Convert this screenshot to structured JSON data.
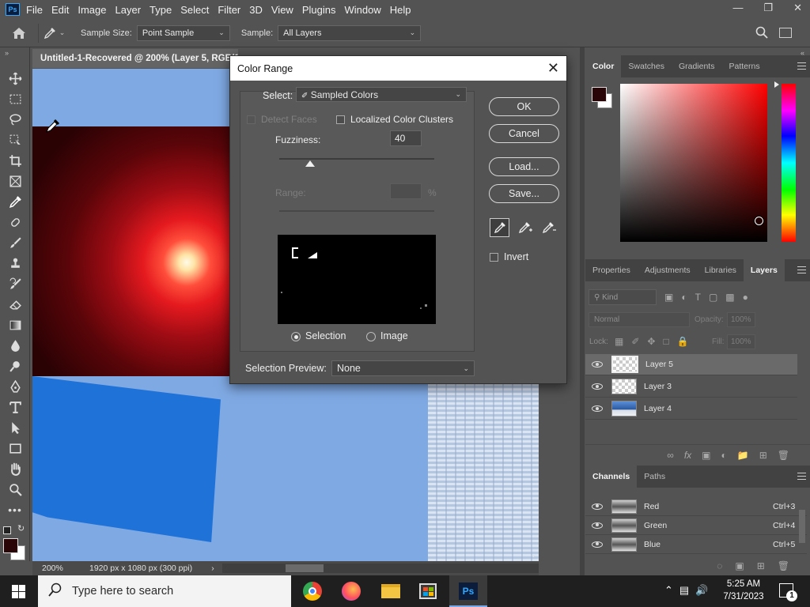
{
  "app": {
    "logo_text": "Ps",
    "menu": [
      "File",
      "Edit",
      "Image",
      "Layer",
      "Type",
      "Select",
      "Filter",
      "3D",
      "View",
      "Plugins",
      "Window",
      "Help"
    ]
  },
  "options": {
    "sample_size_label": "Sample Size:",
    "sample_size_value": "Point Sample",
    "sample_label": "Sample:",
    "sample_value": "All Layers"
  },
  "document": {
    "tab_title": "Untitled-1-Recovered @ 200% (Layer 5, RGB/16#)",
    "zoom": "200%",
    "doc_info": "1920 px x 1080 px (300 ppi)"
  },
  "dialog": {
    "title": "Color Range",
    "select_label": "Select:",
    "select_value": "Sampled Colors",
    "detect_faces_label": "Detect Faces",
    "localized_label": "Localized Color Clusters",
    "fuzziness_label": "Fuzziness:",
    "fuzziness_value": "40",
    "fuzziness_level": 0.2,
    "range_label": "Range:",
    "range_unit": "%",
    "selection_radio": "Selection",
    "image_radio": "Image",
    "preview_label": "Selection Preview:",
    "preview_value": "None",
    "ok": "OK",
    "cancel": "Cancel",
    "load": "Load...",
    "save": "Save...",
    "invert": "Invert"
  },
  "color_panel": {
    "tabs": [
      "Color",
      "Swatches",
      "Gradients",
      "Patterns"
    ],
    "foreground": "#2a0508",
    "background": "#ffffff"
  },
  "layers_panel": {
    "tabs": [
      "Properties",
      "Adjustments",
      "Libraries",
      "Layers"
    ],
    "kind_placeholder": "Kind",
    "blend_mode": "Normal",
    "opacity_label": "Opacity:",
    "opacity_value": "100%",
    "lock_label": "Lock:",
    "fill_label": "Fill:",
    "fill_value": "100%",
    "layers": [
      {
        "name": "Layer 5"
      },
      {
        "name": "Layer 3"
      },
      {
        "name": "Layer 4"
      }
    ]
  },
  "channels_panel": {
    "tabs": [
      "Channels",
      "Paths"
    ],
    "channels": [
      {
        "name": "Red",
        "shortcut": "Ctrl+3"
      },
      {
        "name": "Green",
        "shortcut": "Ctrl+4"
      },
      {
        "name": "Blue",
        "shortcut": "Ctrl+5"
      }
    ]
  },
  "taskbar": {
    "search_placeholder": "Type here to search",
    "time": "5:25 AM",
    "date": "7/31/2023",
    "notification_count": "1"
  }
}
